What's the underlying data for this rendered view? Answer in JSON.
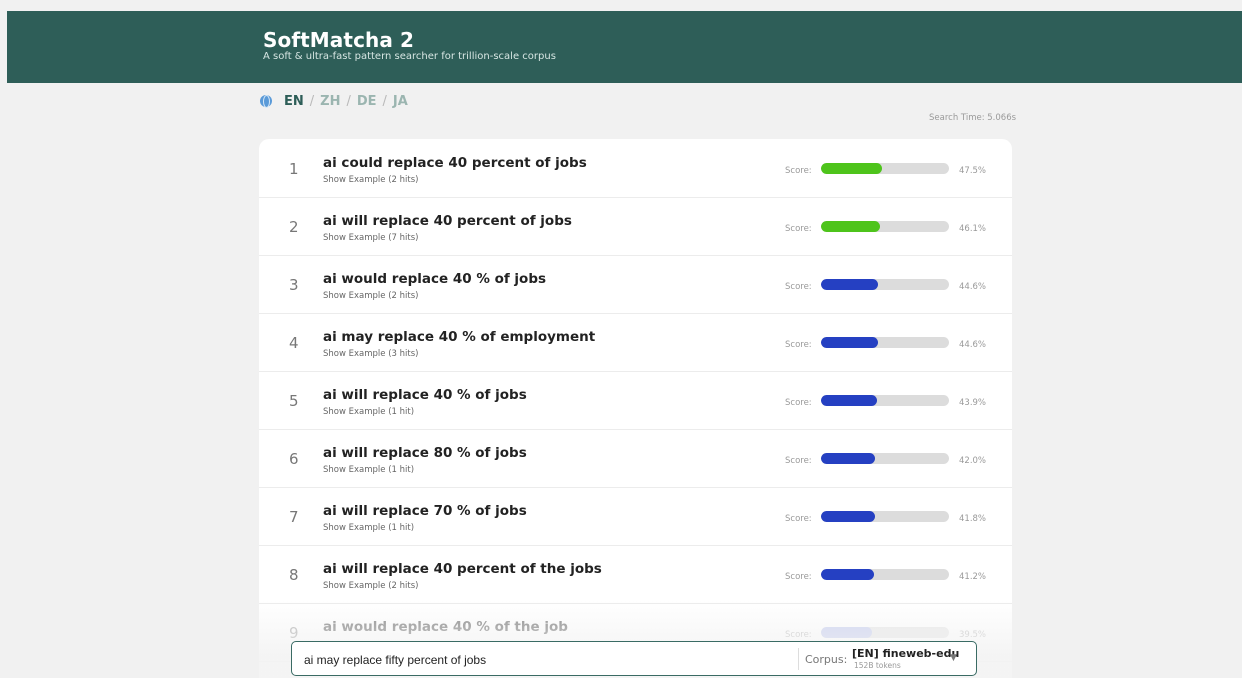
{
  "app": {
    "title": "SoftMatcha 2",
    "subtitle": "A soft & ultra-fast pattern searcher for trillion-scale corpus"
  },
  "languages": {
    "active": "EN",
    "others": [
      "ZH",
      "DE",
      "JA"
    ],
    "separator": "/"
  },
  "search_time": "Search Time: 5.066s",
  "score_label": "Score:",
  "colors": {
    "high": "#4ec41b",
    "mid": "#2540c2",
    "faded": "#a9b4e8",
    "header": "#2e5e58"
  },
  "results": [
    {
      "rank": "1",
      "phrase": "ai could replace 40 percent of jobs",
      "example": "Show Example (2 hits)",
      "score": 0.475,
      "score_text": "47.5%",
      "color": "high"
    },
    {
      "rank": "2",
      "phrase": "ai will replace 40 percent of jobs",
      "example": "Show Example (7 hits)",
      "score": 0.461,
      "score_text": "46.1%",
      "color": "high"
    },
    {
      "rank": "3",
      "phrase": "ai would replace 40 % of jobs",
      "example": "Show Example (2 hits)",
      "score": 0.446,
      "score_text": "44.6%",
      "color": "mid"
    },
    {
      "rank": "4",
      "phrase": "ai may replace 40 % of employment",
      "example": "Show Example (3 hits)",
      "score": 0.446,
      "score_text": "44.6%",
      "color": "mid"
    },
    {
      "rank": "5",
      "phrase": "ai will replace 40 % of jobs",
      "example": "Show Example (1 hit)",
      "score": 0.439,
      "score_text": "43.9%",
      "color": "mid"
    },
    {
      "rank": "6",
      "phrase": "ai will replace 80 % of jobs",
      "example": "Show Example (1 hit)",
      "score": 0.42,
      "score_text": "42.0%",
      "color": "mid"
    },
    {
      "rank": "7",
      "phrase": "ai will replace 70 % of jobs",
      "example": "Show Example (1 hit)",
      "score": 0.418,
      "score_text": "41.8%",
      "color": "mid"
    },
    {
      "rank": "8",
      "phrase": "ai will replace 40 percent of the jobs",
      "example": "Show Example (2 hits)",
      "score": 0.412,
      "score_text": "41.2%",
      "color": "mid"
    },
    {
      "rank": "9",
      "phrase": "ai would replace 40 % of the job",
      "example": "",
      "score": 0.395,
      "score_text": "39.5%",
      "color": "faded"
    }
  ],
  "search": {
    "query": "ai may replace fifty percent of jobs",
    "corpus_label": "Corpus:",
    "corpus_name": "[EN] fineweb-edu",
    "corpus_tokens": "152B tokens"
  }
}
